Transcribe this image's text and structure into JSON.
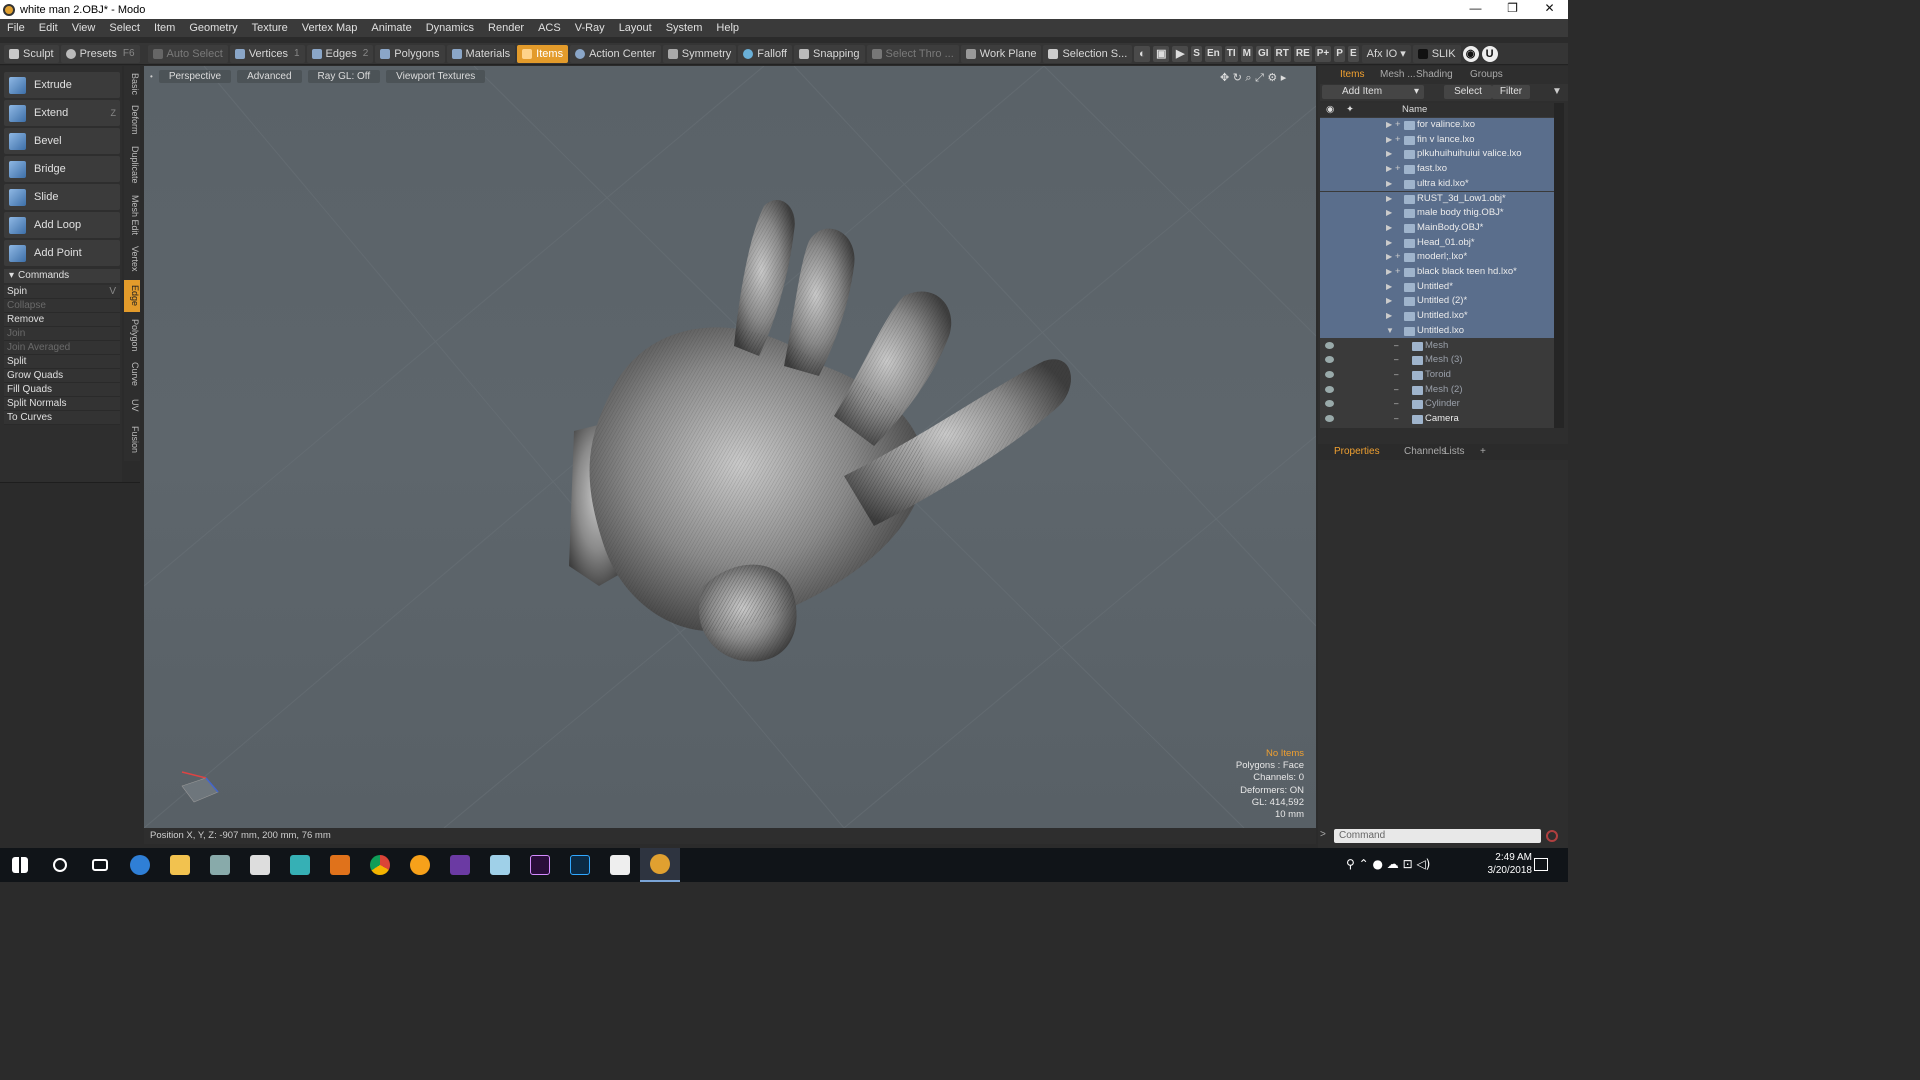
{
  "window": {
    "title": "white man 2.OBJ* - Modo",
    "minimize": "—",
    "maximize": "❐",
    "close": "✕"
  },
  "menu": [
    "File",
    "Edit",
    "View",
    "Select",
    "Item",
    "Geometry",
    "Texture",
    "Vertex Map",
    "Animate",
    "Dynamics",
    "Render",
    "ACS",
    "V-Ray",
    "Layout",
    "System",
    "Help"
  ],
  "toolbar": {
    "sculpt": "Sculpt",
    "presets": "Presets",
    "presets_key": "F6",
    "auto_select": "Auto Select",
    "vertices": "Vertices",
    "vertices_key": "1",
    "edges": "Edges",
    "edges_key": "2",
    "polygons": "Polygons",
    "materials": "Materials",
    "items": "Items",
    "action_center": "Action Center",
    "symmetry": "Symmetry",
    "falloff": "Falloff",
    "snapping": "Snapping",
    "select_through": "Select Thro ...",
    "work_plane": "Work Plane",
    "selection_sets": "Selection S...",
    "right_letters": [
      "S",
      "En",
      "TI",
      "M",
      "GI",
      "RT",
      "RE",
      "P+",
      "P",
      "E"
    ],
    "afx": "Afx IO",
    "slik": "SLIK"
  },
  "tools": [
    {
      "label": "Extrude",
      "key": ""
    },
    {
      "label": "Extend",
      "key": "Z"
    },
    {
      "label": "Bevel",
      "key": ""
    },
    {
      "label": "Bridge",
      "key": ""
    },
    {
      "label": "Slide",
      "key": ""
    },
    {
      "label": "Add Loop",
      "key": ""
    },
    {
      "label": "Add Point",
      "key": ""
    }
  ],
  "commands_header": "Commands",
  "commands": [
    {
      "label": "Spin",
      "key": "V",
      "disabled": false
    },
    {
      "label": "Collapse",
      "key": "",
      "disabled": true
    },
    {
      "label": "Remove",
      "key": "",
      "disabled": false
    },
    {
      "label": "Join",
      "key": "",
      "disabled": true
    },
    {
      "label": "Join Averaged",
      "key": "",
      "disabled": true
    },
    {
      "label": "Split",
      "key": "",
      "disabled": false
    },
    {
      "label": "Grow Quads",
      "key": "",
      "disabled": false
    },
    {
      "label": "Fill Quads",
      "key": "",
      "disabled": false
    },
    {
      "label": "Split Normals",
      "key": "",
      "disabled": false
    },
    {
      "label": "To Curves",
      "key": "",
      "disabled": false
    }
  ],
  "vertical_tabs": [
    "Basic",
    "Deform",
    "Duplicate",
    "Mesh Edit",
    "Vertex",
    "Edge",
    "Polygon",
    "Curve",
    "UV",
    "Fusion"
  ],
  "active_vtab": "Edge",
  "viewport": {
    "buttons": [
      "Perspective",
      "Advanced",
      "Ray GL: Off",
      "Viewport Textures"
    ],
    "stats": {
      "no_items": "No Items",
      "polygons": "Polygons : Face",
      "channels": "Channels: 0",
      "deformers": "Deformers: ON",
      "gl": "GL: 414,592",
      "scale": "10 mm"
    },
    "position": "Position X, Y, Z:   -907 mm, 200 mm, 76 mm"
  },
  "right_panel": {
    "tabs": [
      "Items",
      "Mesh ...",
      "Shading",
      "Groups"
    ],
    "add_item": "Add Item",
    "select": "Select",
    "filter": "Filter",
    "name_col": "Name",
    "items": [
      {
        "label": "for valince.lxo",
        "indent": 0,
        "plus": true,
        "sub": false
      },
      {
        "label": "fin v lance.lxo",
        "indent": 0,
        "plus": true,
        "sub": false
      },
      {
        "label": "plkuhuihuihuiui valice.lxo",
        "indent": 0,
        "plus": false,
        "sub": false
      },
      {
        "label": "fast.lxo",
        "indent": 0,
        "plus": true,
        "sub": false
      },
      {
        "label": "ultra kid.lxo*",
        "indent": 0,
        "plus": false,
        "sub": false
      },
      {
        "label": "RUST_3d_Low1.obj*",
        "indent": 0,
        "plus": false,
        "sub": false
      },
      {
        "label": "male body thig.OBJ*",
        "indent": 0,
        "plus": false,
        "sub": false
      },
      {
        "label": "MainBody.OBJ*",
        "indent": 0,
        "plus": false,
        "sub": false
      },
      {
        "label": "Head_01.obj*",
        "indent": 0,
        "plus": false,
        "sub": false
      },
      {
        "label": "moderl;.lxo*",
        "indent": 0,
        "plus": true,
        "sub": false
      },
      {
        "label": "black black teen hd.lxo*",
        "indent": 0,
        "plus": true,
        "sub": false
      },
      {
        "label": "Untitled*",
        "indent": 0,
        "plus": false,
        "sub": false
      },
      {
        "label": "Untitled (2)*",
        "indent": 0,
        "plus": false,
        "sub": false
      },
      {
        "label": "Untitled.lxo*",
        "indent": 0,
        "plus": false,
        "sub": false
      },
      {
        "label": "Untitled.lxo",
        "indent": 0,
        "plus": false,
        "sub": false,
        "open": true
      },
      {
        "label": "Mesh",
        "indent": 1,
        "plus": false,
        "sub": true
      },
      {
        "label": "Mesh (3)",
        "indent": 1,
        "plus": false,
        "sub": true
      },
      {
        "label": "Toroid",
        "indent": 1,
        "plus": false,
        "sub": true
      },
      {
        "label": "Mesh (2)",
        "indent": 1,
        "plus": false,
        "sub": true
      },
      {
        "label": "Cylinder",
        "indent": 1,
        "plus": false,
        "sub": true
      },
      {
        "label": "Camera",
        "indent": 1,
        "plus": false,
        "sub": false
      }
    ],
    "props_tabs": [
      "Properties",
      "Channels",
      "Lists"
    ],
    "command_placeholder": "Command"
  },
  "taskbar": {
    "time": "2:49 AM",
    "date": "3/20/2018"
  }
}
